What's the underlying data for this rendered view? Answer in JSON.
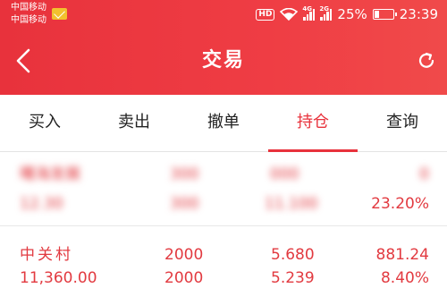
{
  "status_bar": {
    "carrier_1": "中国移动",
    "carrier_2": "中国移动",
    "hd": "HD",
    "net_1": "4G",
    "net_2": "2G",
    "battery_percent": "25%",
    "battery_level": 0.25,
    "time": "23:39"
  },
  "header": {
    "title": "交易",
    "back_icon": "chevron-left-icon",
    "refresh_icon": "refresh-icon"
  },
  "tabs": [
    {
      "label": "买入"
    },
    {
      "label": "卖出"
    },
    {
      "label": "撤单"
    },
    {
      "label": "持仓",
      "active": true
    },
    {
      "label": "查询"
    }
  ],
  "positions": [
    {
      "name": "曙海发展",
      "value": "12.30",
      "qty": "300",
      "qty2": "300",
      "price": "000",
      "cost": "11.100",
      "pnl": "0",
      "pnl_pct": "23.20%"
    },
    {
      "name": "中关村",
      "value": "11,360.00",
      "qty": "2000",
      "qty2": "2000",
      "price": "5.680",
      "cost": "5.239",
      "pnl": "881.24",
      "pnl_pct": "8.40%"
    }
  ],
  "colors": {
    "brand_red": "#e8323c",
    "text_dark": "#222222",
    "up_red": "#e23a40"
  }
}
